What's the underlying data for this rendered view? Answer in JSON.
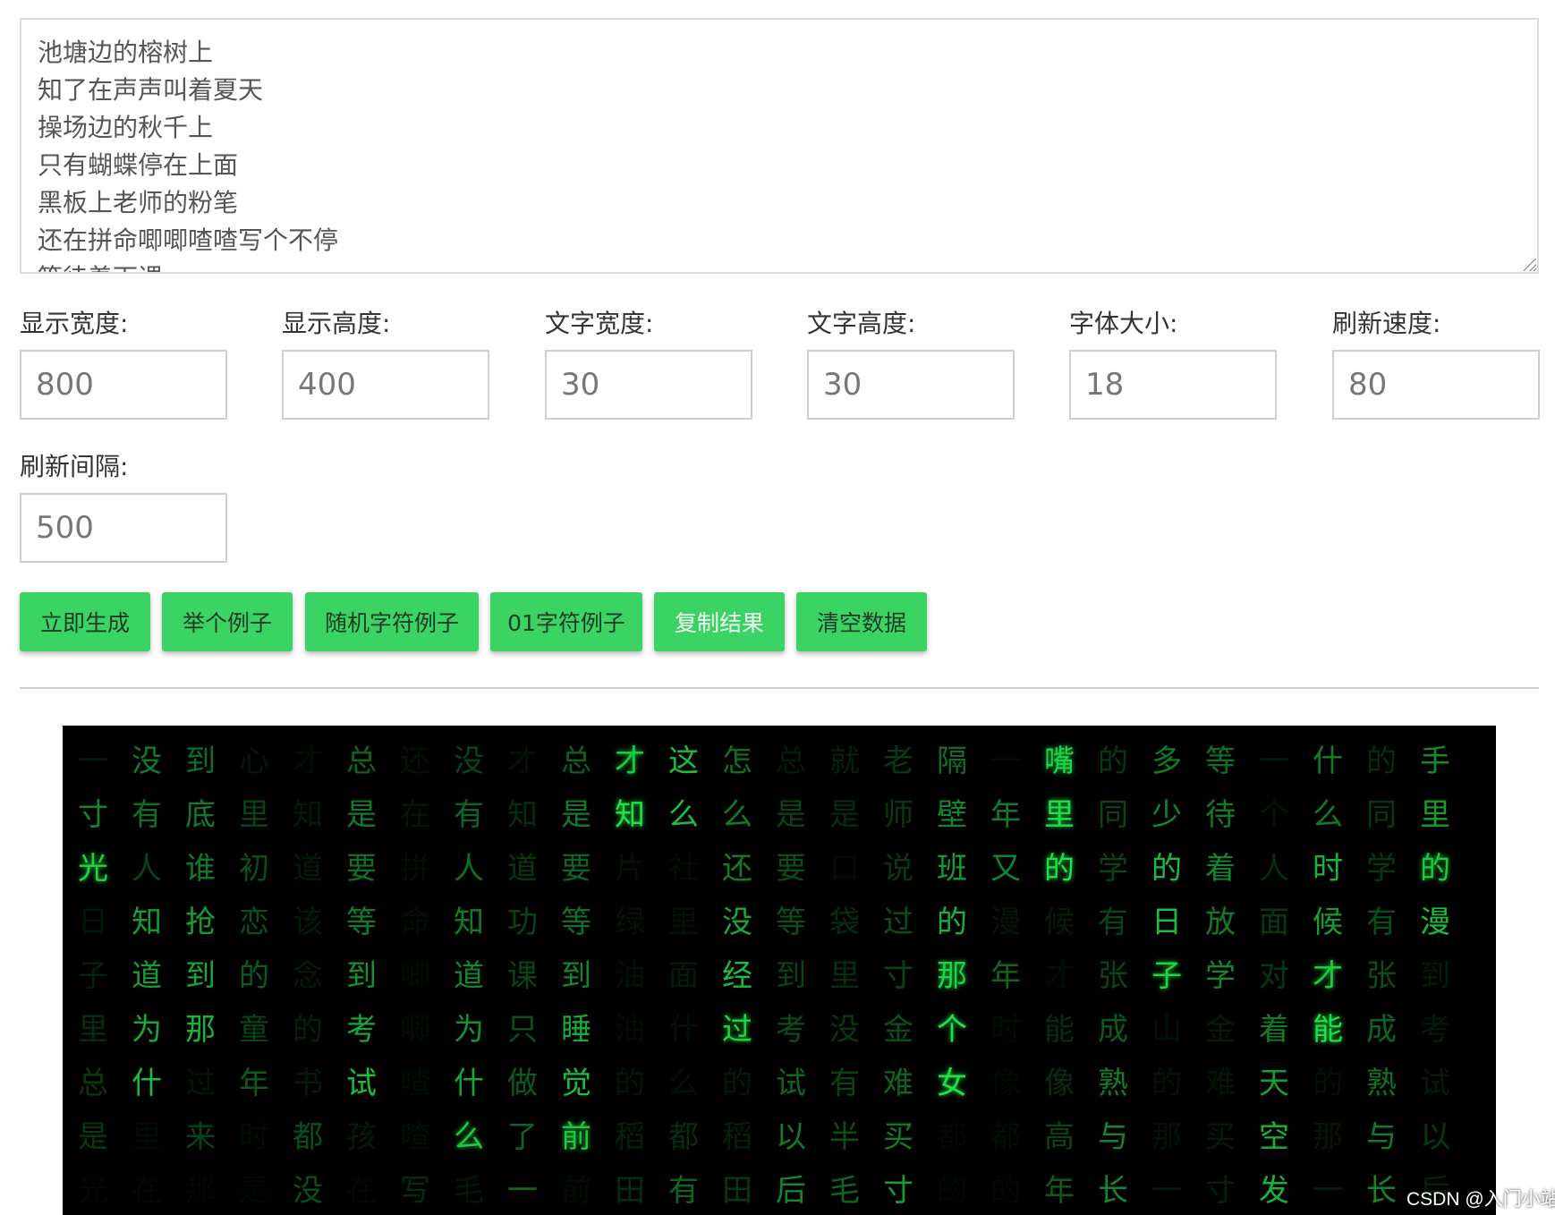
{
  "lyrics_text": "池塘边的榕树上\n知了在声声叫着夏天\n操场边的秋千上\n只有蝴蝶停在上面\n黑板上老师的粉笔\n还在拼命唧唧喳喳写个不停\n等待着下课",
  "fields": {
    "display_width": {
      "label": "显示宽度:",
      "value": "800"
    },
    "display_height": {
      "label": "显示高度:",
      "value": "400"
    },
    "text_width": {
      "label": "文字宽度:",
      "value": "30"
    },
    "text_height": {
      "label": "文字高度:",
      "value": "30"
    },
    "font_size": {
      "label": "字体大小:",
      "value": "18"
    },
    "refresh_speed": {
      "label": "刷新速度:",
      "value": "80"
    },
    "refresh_interval": {
      "label": "刷新间隔:",
      "value": "500"
    }
  },
  "buttons": {
    "generate": "立即生成",
    "example": "举个例子",
    "random_example": "随机字符例子",
    "binary_example": "01字符例子",
    "copy_result": "复制结果",
    "clear_data": "清空数据"
  },
  "matrix": {
    "background": "#000000",
    "glyph_color": "#1fe04a",
    "rows": [
      "一没到心才总还没才总才这怎总就老隔一嘴的多等一什的手",
      "寸有底里知是在有知是知么么是是师壁年里同少待个么同里",
      "光人谁初道要拼人道要片社还要口说班又的学的着人时学的",
      "日知抢恋该等命知功等绿里没等袋过的漫候有日放面候有漫",
      "子道到的念到唧道课到油面经到里寸那年才张子学对才张到",
      "里为那童的考唧为只睡油什过考没金个时能成山金着能成考",
      "总什过年书试喳什做觉的么的试有难女像像熟的难天的熟试",
      "是里来时都孩喳么了前稻都稻以半买都都高与那买空那与以",
      "光在那是没在写毛一前田有田后毛寸的的年长一寸发一长后"
    ],
    "levels": [
      [
        0.12,
        0.55,
        0.5,
        0.1,
        0.06,
        0.45,
        0.08,
        0.3,
        0.08,
        0.42,
        0.9,
        0.85,
        0.5,
        0.12,
        0.15,
        0.25,
        0.5,
        0.06,
        0.95,
        0.25,
        0.55,
        0.5,
        0.12,
        0.55,
        0.2,
        0.62
      ],
      [
        0.6,
        0.5,
        0.55,
        0.3,
        0.12,
        0.55,
        0.1,
        0.45,
        0.2,
        0.55,
        1.0,
        0.85,
        0.55,
        0.3,
        0.2,
        0.25,
        0.6,
        0.55,
        1.0,
        0.3,
        0.6,
        0.55,
        0.1,
        0.55,
        0.25,
        0.7
      ],
      [
        0.95,
        0.3,
        0.55,
        0.35,
        0.12,
        0.5,
        0.06,
        0.5,
        0.25,
        0.45,
        0.08,
        0.06,
        0.55,
        0.35,
        0.06,
        0.25,
        0.7,
        0.6,
        1.0,
        0.3,
        0.85,
        0.6,
        0.2,
        0.8,
        0.25,
        0.9
      ],
      [
        0.1,
        0.7,
        0.7,
        0.35,
        0.12,
        0.55,
        0.06,
        0.55,
        0.3,
        0.5,
        0.08,
        0.08,
        0.75,
        0.35,
        0.2,
        0.35,
        0.8,
        0.1,
        0.12,
        0.3,
        0.85,
        0.55,
        0.25,
        0.7,
        0.35,
        0.85
      ],
      [
        0.15,
        0.7,
        0.75,
        0.4,
        0.12,
        0.65,
        0.06,
        0.6,
        0.3,
        0.6,
        0.08,
        0.12,
        0.85,
        0.3,
        0.2,
        0.3,
        0.95,
        0.45,
        0.06,
        0.3,
        0.95,
        0.6,
        0.25,
        0.9,
        0.35,
        0.12
      ],
      [
        0.2,
        0.75,
        0.8,
        0.3,
        0.15,
        0.75,
        0.06,
        0.65,
        0.35,
        0.75,
        0.06,
        0.08,
        0.95,
        0.35,
        0.25,
        0.35,
        1.0,
        0.06,
        0.2,
        0.4,
        0.08,
        0.12,
        0.55,
        1.0,
        0.45,
        0.12
      ],
      [
        0.25,
        0.85,
        0.1,
        0.4,
        0.12,
        0.85,
        0.06,
        0.75,
        0.4,
        0.85,
        0.1,
        0.08,
        0.12,
        0.45,
        0.3,
        0.45,
        1.0,
        0.04,
        0.2,
        0.55,
        0.08,
        0.1,
        0.7,
        0.08,
        0.5,
        0.12
      ],
      [
        0.25,
        0.05,
        0.3,
        0.06,
        0.35,
        0.12,
        0.06,
        0.9,
        0.45,
        0.9,
        0.15,
        0.2,
        0.15,
        0.55,
        0.35,
        0.55,
        0.04,
        0.06,
        0.3,
        0.6,
        0.08,
        0.12,
        0.8,
        0.1,
        0.55,
        0.25
      ],
      [
        0.04,
        0.04,
        0.04,
        0.04,
        0.35,
        0.04,
        0.2,
        0.1,
        0.45,
        0.06,
        0.2,
        0.45,
        0.25,
        0.6,
        0.45,
        0.7,
        0.04,
        0.04,
        0.4,
        0.6,
        0.12,
        0.15,
        0.8,
        0.15,
        0.6,
        0.15
      ]
    ]
  },
  "watermark": "CSDN @入门小站"
}
